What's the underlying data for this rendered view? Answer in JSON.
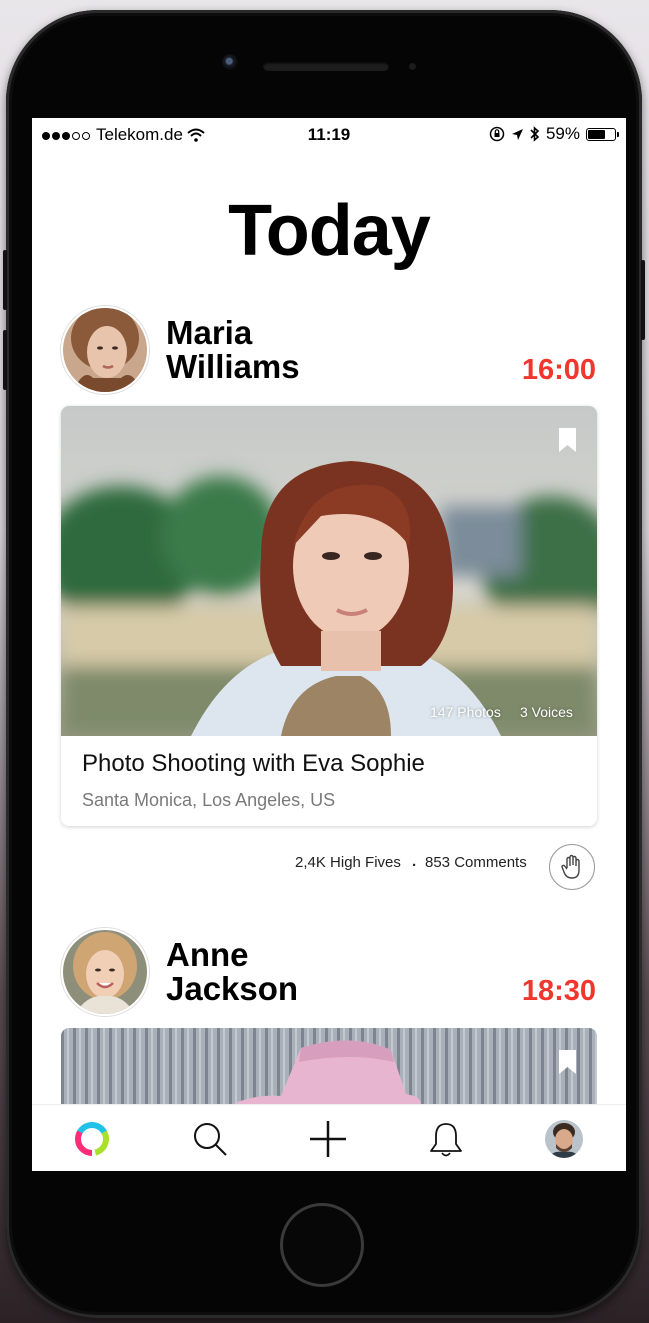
{
  "status_bar": {
    "carrier": "Telekom.de",
    "time": "11:19",
    "battery": "59%",
    "battery_level": 0.59
  },
  "page_title": "Today",
  "posts": [
    {
      "user_first": "Maria",
      "user_last": "Williams",
      "time": "16:00",
      "card_title": "Photo Shooting with Eva Sophie",
      "card_location": "Santa Monica, Los Angeles, US",
      "photos": "147 Photos",
      "voices": "3 Voices",
      "high_fives": "2,4K High Fives",
      "separator": ".",
      "comments": "853 Comments"
    },
    {
      "user_first": "Anne",
      "user_last": "Jackson",
      "time": "18:30"
    }
  ],
  "tab_bar": {
    "items": [
      "activity-icon",
      "search-icon",
      "plus-icon",
      "bell-icon",
      "profile-avatar"
    ]
  },
  "colors": {
    "accent_red": "#f0362d"
  }
}
